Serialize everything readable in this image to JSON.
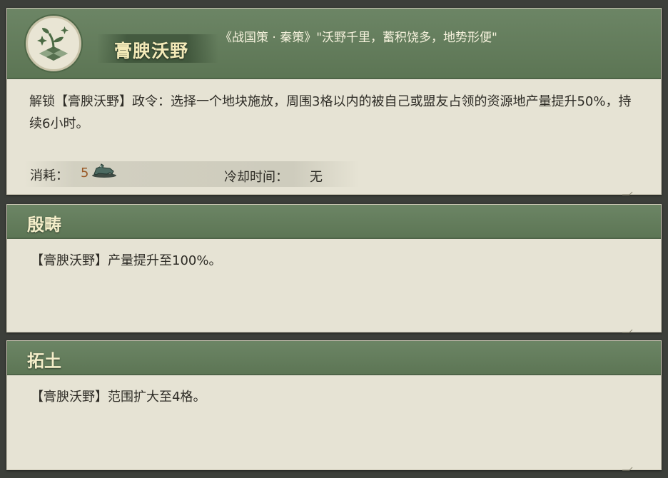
{
  "main_skill": {
    "name": "膏腴沃野",
    "quote": "《战国策 · 秦策》\"沃野千里，蓄积饶多，地势形便\"",
    "description": "解锁【膏腴沃野】政令：选择一个地块施放，周围3格以内的被自己或盟友占领的资源地产量提升50%，持续6小时。",
    "cost_label": "消耗：",
    "cost_value": "5",
    "cost_icon": "horse-token-icon",
    "cooldown_label": "冷却时间：",
    "cooldown_value": "无"
  },
  "upgrades": [
    {
      "title": "殷畴",
      "description": "【膏腴沃野】产量提升至100%。"
    },
    {
      "title": "拓土",
      "description": "【膏腴沃野】范围扩大至4格。"
    }
  ],
  "colors": {
    "header_green": "#5f7857",
    "panel_paper": "#e6e3d4",
    "name_gold": "#f2e9b7",
    "cost_orange": "#9a5a28"
  }
}
